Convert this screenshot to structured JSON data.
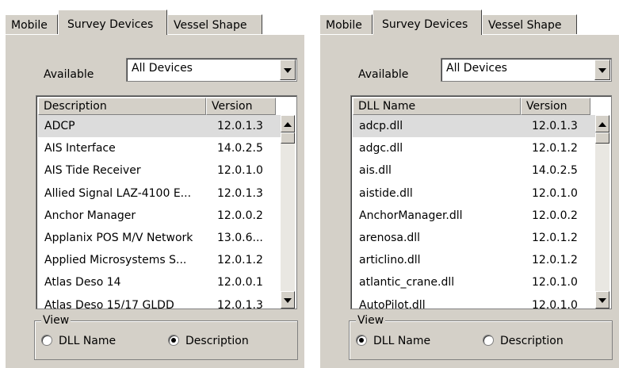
{
  "left": {
    "tabs": [
      "Mobile",
      "Survey Devices",
      "Vessel Shape"
    ],
    "available_label": "Available",
    "combo_value": "All Devices",
    "columns": [
      "Description",
      "Version"
    ],
    "rows": [
      [
        "ADCP",
        "12.0.1.3"
      ],
      [
        "AIS Interface",
        "14.0.2.5"
      ],
      [
        "AIS Tide Receiver",
        "12.0.1.0"
      ],
      [
        "Allied Signal LAZ-4100 E...",
        "12.0.1.3"
      ],
      [
        "Anchor Manager",
        "12.0.0.2"
      ],
      [
        "Applanix POS M/V Network",
        "13.0.6..."
      ],
      [
        "Applied Microsystems S...",
        "12.0.1.2"
      ],
      [
        "Atlas Deso 14",
        "12.0.0.1"
      ],
      [
        "Atlas Deso 15/17 GLDD",
        "12.0.1.3"
      ]
    ],
    "selected_row": 0,
    "view_label": "View",
    "view_options": [
      "DLL Name",
      "Description"
    ],
    "view_selected": "Description"
  },
  "right": {
    "tabs": [
      "Mobile",
      "Survey Devices",
      "Vessel Shape"
    ],
    "available_label": "Available",
    "combo_value": "All Devices",
    "columns": [
      "DLL Name",
      "Version"
    ],
    "rows": [
      [
        "adcp.dll",
        "12.0.1.3"
      ],
      [
        "adgc.dll",
        "12.0.1.2"
      ],
      [
        "ais.dll",
        "14.0.2.5"
      ],
      [
        "aistide.dll",
        "12.0.1.0"
      ],
      [
        "AnchorManager.dll",
        "12.0.0.2"
      ],
      [
        "arenosa.dll",
        "12.0.1.2"
      ],
      [
        "articlino.dll",
        "12.0.1.2"
      ],
      [
        "atlantic_crane.dll",
        "12.0.1.0"
      ],
      [
        "AutoPilot.dll",
        "12.0.1.0"
      ]
    ],
    "selected_row": 0,
    "view_label": "View",
    "view_options": [
      "DLL Name",
      "Description"
    ],
    "view_selected": "DLL Name"
  }
}
